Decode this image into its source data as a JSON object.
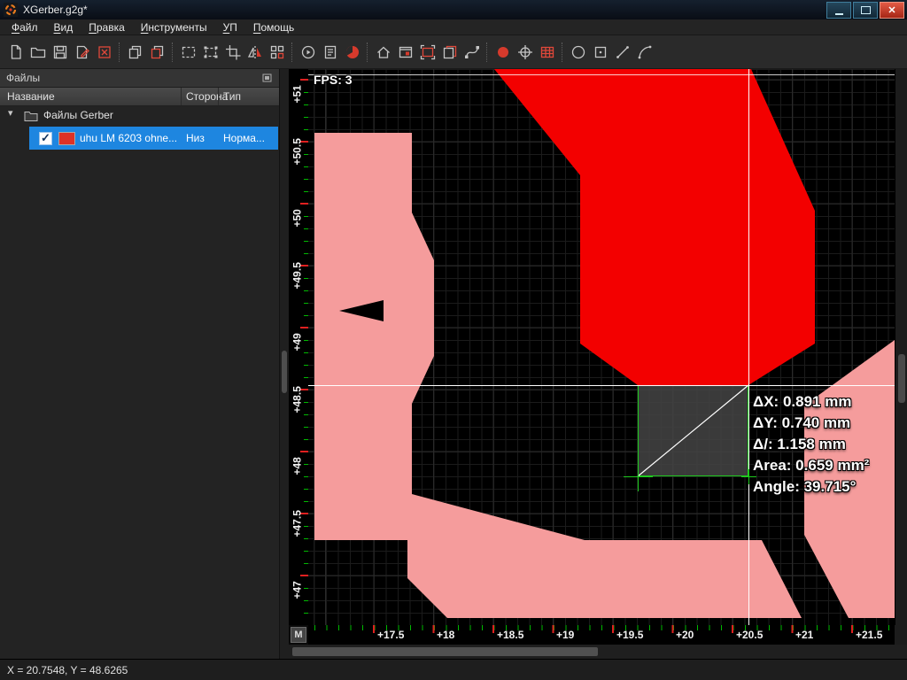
{
  "window": {
    "title": "XGerber.g2g*"
  },
  "menu": {
    "items": [
      "Файл",
      "Вид",
      "Правка",
      "Инструменты",
      "УП",
      "Помощь"
    ]
  },
  "toolbar": {
    "icons": [
      "new-file-icon",
      "open-file-icon",
      "save-icon",
      "edit-file-icon",
      "close-file-icon",
      "copy-icon",
      "export-icon",
      "select-rect-icon",
      "select-handles-icon",
      "crop-icon",
      "mirror-icon",
      "array-icon",
      "run-icon",
      "report-icon",
      "aperture-pie-icon",
      "home-icon",
      "panel-icon",
      "frame-icon",
      "layers-icon",
      "spline-icon",
      "flash-circle-icon",
      "center-cross-icon",
      "net-grid-icon",
      "draw-circle-icon",
      "draw-pad-icon",
      "draw-line-icon",
      "draw-arc-icon"
    ]
  },
  "files_panel": {
    "title": "Файлы",
    "columns": [
      "Название",
      "Сторона",
      "Тип"
    ],
    "root_label": "Файлы Gerber",
    "file": {
      "name": "uhu LM 6203  ohne...",
      "side": "Низ",
      "type": "Норма...",
      "checked": true,
      "color": "#de3226"
    }
  },
  "canvas": {
    "fps": "FPS: 3",
    "ruler_x": [
      "+17.5",
      "+18",
      "+18.5",
      "+19",
      "+19.5",
      "+20",
      "+20.5",
      "+21",
      "+21.5"
    ],
    "ruler_y": [
      "+51",
      "+50.5",
      "+50",
      "+49.5",
      "+49",
      "+48.5",
      "+48",
      "+47.5",
      "+47"
    ],
    "units": "M",
    "measurement": {
      "dx": "ΔX: 0.891 mm",
      "dy": "ΔY: 0.740 mm",
      "dl": "Δ/: 1.158 mm",
      "area": "Area: 0.659 mm²",
      "angle": "Angle: 39.715°"
    },
    "colors": {
      "copper": "#f30000",
      "copper_light": "#f59c9c",
      "measure": "#1ecb1e",
      "grid": "#1b1b1b"
    }
  },
  "status": {
    "coords": "X = 20.7548, Y = 48.6265"
  }
}
